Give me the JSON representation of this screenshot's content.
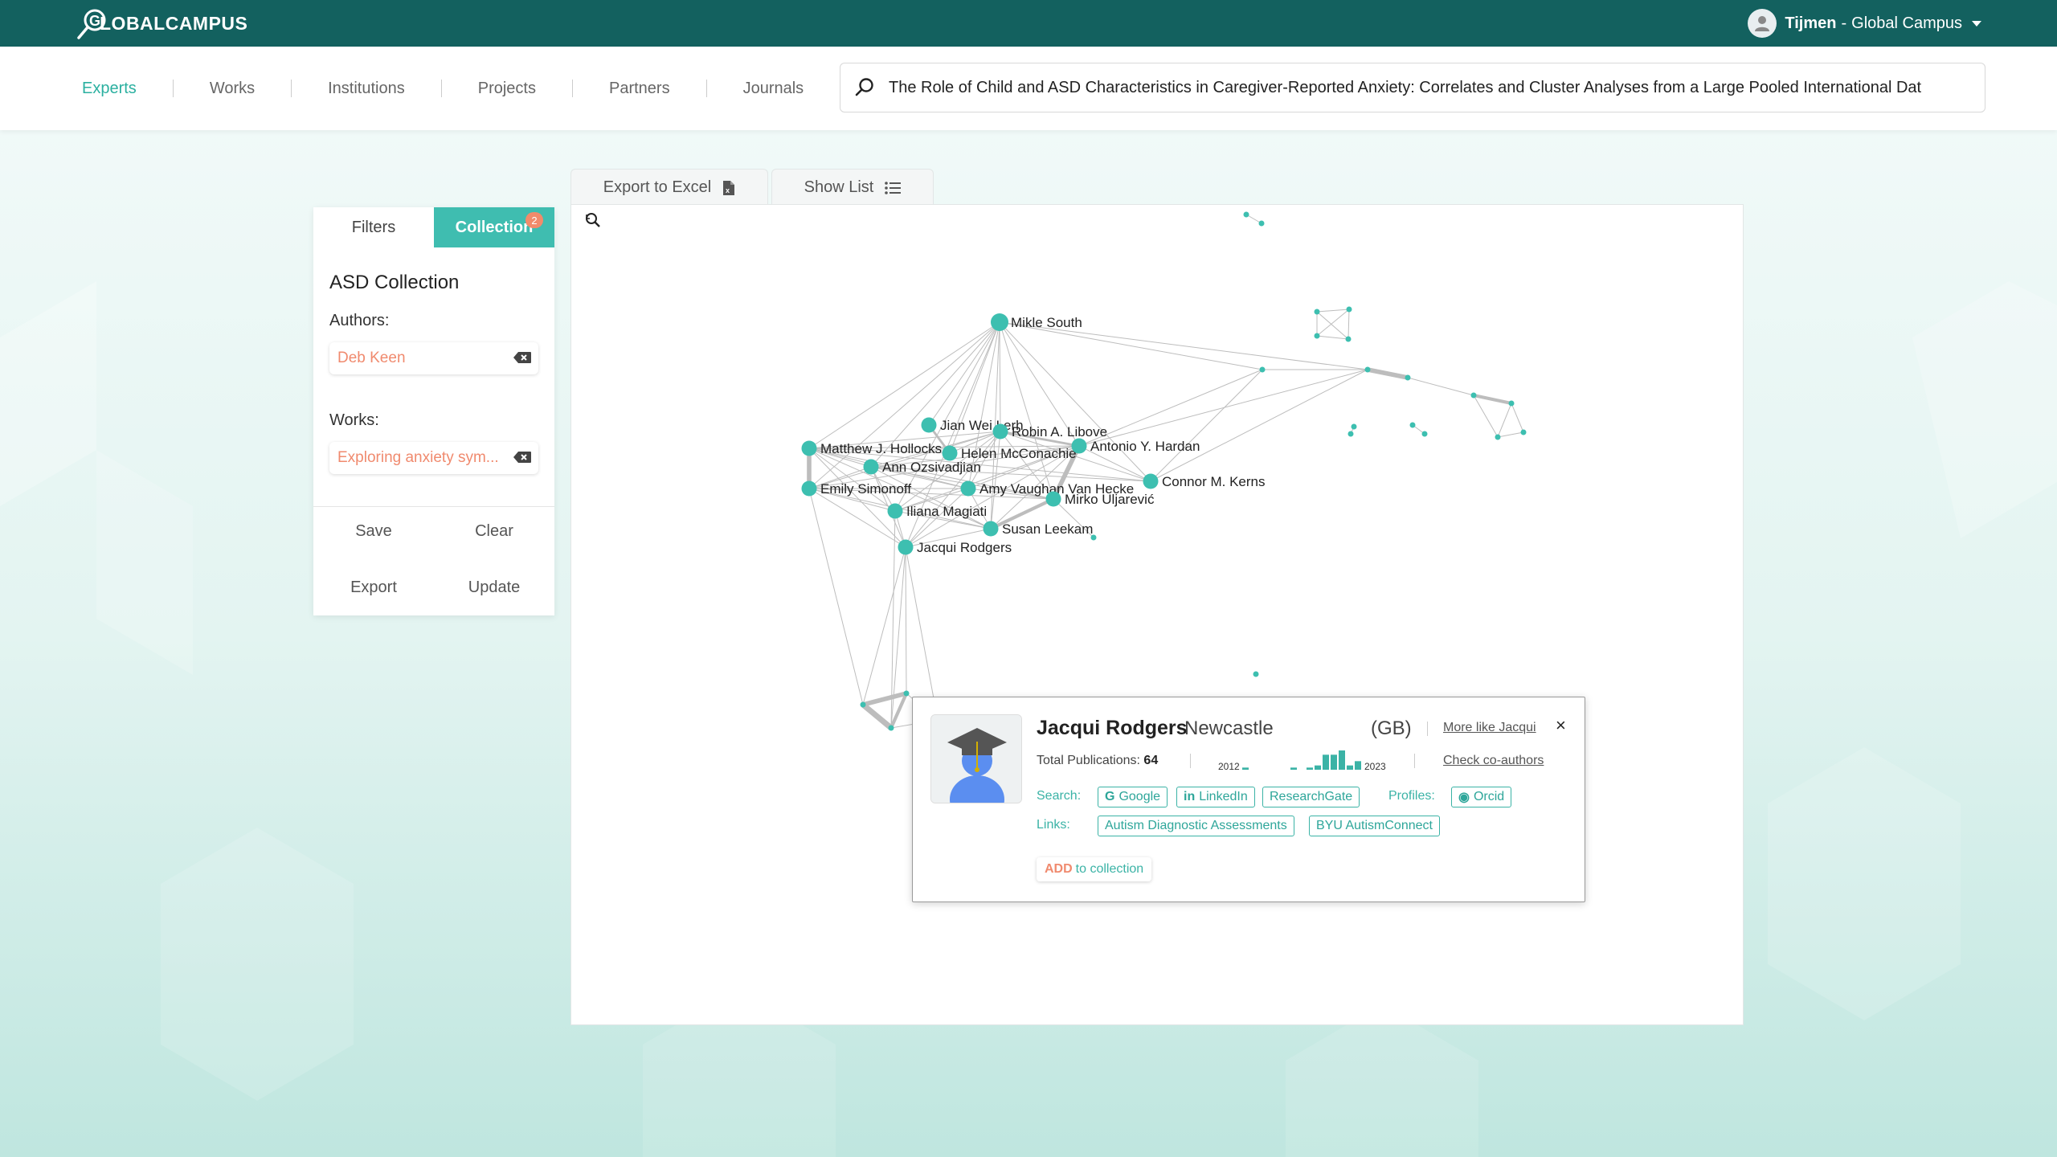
{
  "app": {
    "logo_text": "LOBALCAMPUS",
    "user_name": "Tijmen",
    "user_sep": "-",
    "user_org": "Global Campus"
  },
  "nav": {
    "tabs": [
      "Experts",
      "Works",
      "Institutions",
      "Projects",
      "Partners",
      "Journals"
    ],
    "active": "Experts",
    "search_value": "The Role of Child and ASD Characteristics in Caregiver-Reported Anxiety: Correlates and Cluster Analyses from a Large Pooled International Dat"
  },
  "toolbar": {
    "export_label": "Export to Excel",
    "show_list_label": "Show List"
  },
  "sidebar": {
    "tab_filters": "Filters",
    "tab_collection": "Collection",
    "collection_badge": "2",
    "collection_title": "ASD Collection",
    "authors_label": "Authors:",
    "author_chip": "Deb Keen",
    "works_label": "Works:",
    "work_chip": "Exploring anxiety sym...",
    "save": "Save",
    "clear": "Clear",
    "export": "Export",
    "update": "Update"
  },
  "graph": {
    "labels": {
      "mikle_south": "Mikle South",
      "jian_wei_lerh": "Jian Wei Lerh",
      "robin_libove": "Robin A. Libove",
      "matthew_hollocks": "Matthew J. Hollocks",
      "helen_mcconachie": "Helen McConachie",
      "antonio_hardan": "Antonio Y. Hardan",
      "ann_ozsivadjian": "Ann Ozsivadjian",
      "connor_kerns": "Connor M. Kerns",
      "emily_simonoff": "Emily Simonoff",
      "amy_vanhecke": "Amy Vaughan Van Hecke",
      "mirko_uljarevic": "Mirko Uljarević",
      "iliana_maglati": "Iliana Magiati",
      "susan_leekam": "Susan Leekam",
      "jacqui_rodgers": "Jacqui Rodgers"
    },
    "colors": {
      "node": "#3dbfb0",
      "edge": "#bdbdbd"
    }
  },
  "popup": {
    "name": "Jacqui Rodgers",
    "institution": "Newcastle",
    "country": "(GB)",
    "more_like": "More like Jacqui",
    "close": "×",
    "total_pubs_label": "Total Publications:",
    "total_pubs": "64",
    "year_start": "2012",
    "year_end": "2023",
    "pubs_per_year": [
      1,
      0,
      0,
      0,
      0,
      0,
      1,
      0,
      1,
      2,
      7,
      7,
      9,
      2,
      4
    ],
    "check_coauthors": "Check co-authors",
    "search_label": "Search:",
    "search_links": [
      "Google",
      "LinkedIn",
      "ResearchGate"
    ],
    "profiles_label": "Profiles:",
    "profile_links": [
      "Orcid"
    ],
    "links_label": "Links:",
    "links": [
      "Autism Diagnostic Assessments",
      "BYU AutismConnect"
    ],
    "add_strong": "ADD",
    "add_rest": "to collection"
  }
}
